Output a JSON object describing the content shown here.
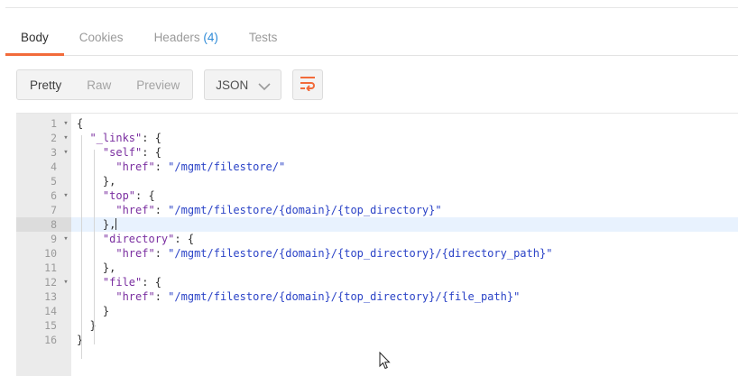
{
  "tabs": [
    {
      "label": "Body",
      "count": "",
      "active": true
    },
    {
      "label": "Cookies",
      "count": "",
      "active": false
    },
    {
      "label": "Headers",
      "count": "(4)",
      "active": false
    },
    {
      "label": "Tests",
      "count": "",
      "active": false
    }
  ],
  "toolbar": {
    "views": [
      {
        "label": "Pretty",
        "active": true
      },
      {
        "label": "Raw",
        "active": false
      },
      {
        "label": "Preview",
        "active": false
      }
    ],
    "format": "JSON",
    "wrap_icon": "wrap-lines-icon"
  },
  "editor": {
    "highlighted_line": 8,
    "lines": [
      {
        "n": "1",
        "fold": true,
        "tokens": [
          [
            "punc",
            "{"
          ]
        ]
      },
      {
        "n": "2",
        "fold": true,
        "tokens": [
          [
            "punc",
            "  "
          ],
          [
            "key",
            "\"_links\""
          ],
          [
            "punc",
            ": {"
          ]
        ]
      },
      {
        "n": "3",
        "fold": true,
        "tokens": [
          [
            "punc",
            "    "
          ],
          [
            "key",
            "\"self\""
          ],
          [
            "punc",
            ": {"
          ]
        ]
      },
      {
        "n": "4",
        "fold": false,
        "tokens": [
          [
            "punc",
            "      "
          ],
          [
            "key",
            "\"href\""
          ],
          [
            "punc",
            ": "
          ],
          [
            "str",
            "\"/mgmt/filestore/\""
          ]
        ]
      },
      {
        "n": "5",
        "fold": false,
        "tokens": [
          [
            "punc",
            "    },"
          ]
        ]
      },
      {
        "n": "6",
        "fold": true,
        "tokens": [
          [
            "punc",
            "    "
          ],
          [
            "key",
            "\"top\""
          ],
          [
            "punc",
            ": {"
          ]
        ]
      },
      {
        "n": "7",
        "fold": false,
        "tokens": [
          [
            "punc",
            "      "
          ],
          [
            "key",
            "\"href\""
          ],
          [
            "punc",
            ": "
          ],
          [
            "str",
            "\"/mgmt/filestore/{domain}/{top_directory}\""
          ]
        ]
      },
      {
        "n": "8",
        "fold": false,
        "tokens": [
          [
            "punc",
            "    },"
          ]
        ]
      },
      {
        "n": "9",
        "fold": true,
        "tokens": [
          [
            "punc",
            "    "
          ],
          [
            "key",
            "\"directory\""
          ],
          [
            "punc",
            ": {"
          ]
        ]
      },
      {
        "n": "10",
        "fold": false,
        "tokens": [
          [
            "punc",
            "      "
          ],
          [
            "key",
            "\"href\""
          ],
          [
            "punc",
            ": "
          ],
          [
            "str",
            "\"/mgmt/filestore/{domain}/{top_directory}/{directory_path}\""
          ]
        ]
      },
      {
        "n": "11",
        "fold": false,
        "tokens": [
          [
            "punc",
            "    },"
          ]
        ]
      },
      {
        "n": "12",
        "fold": true,
        "tokens": [
          [
            "punc",
            "    "
          ],
          [
            "key",
            "\"file\""
          ],
          [
            "punc",
            ": {"
          ]
        ]
      },
      {
        "n": "13",
        "fold": false,
        "tokens": [
          [
            "punc",
            "      "
          ],
          [
            "key",
            "\"href\""
          ],
          [
            "punc",
            ": "
          ],
          [
            "str",
            "\"/mgmt/filestore/{domain}/{top_directory}/{file_path}\""
          ]
        ]
      },
      {
        "n": "14",
        "fold": false,
        "tokens": [
          [
            "punc",
            "    }"
          ]
        ]
      },
      {
        "n": "15",
        "fold": false,
        "tokens": [
          [
            "punc",
            "  }"
          ]
        ]
      },
      {
        "n": "16",
        "fold": false,
        "tokens": [
          [
            "punc",
            "}"
          ]
        ]
      }
    ]
  },
  "colors": {
    "accent": "#f26b3a",
    "link_count": "#2f8bd8",
    "key": "#7a2ea0",
    "string": "#2b43c7"
  }
}
